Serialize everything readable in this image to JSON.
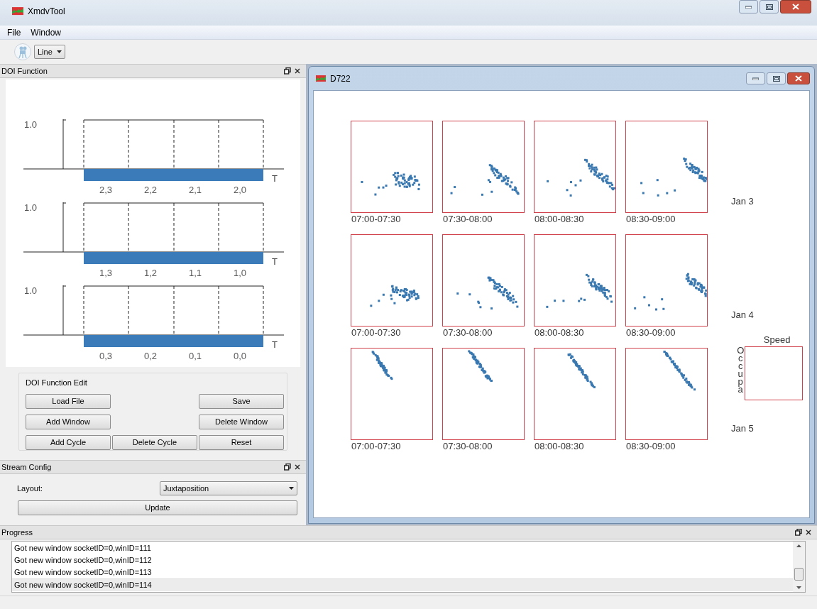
{
  "window": {
    "title": "XmdvTool"
  },
  "menu": [
    "File",
    "Window"
  ],
  "toolbar": {
    "mode": "Line"
  },
  "doi_function": {
    "title": "DOI Function",
    "rows": [
      {
        "y_label": "1.0",
        "axis_label": "T",
        "segments": [
          "2,3",
          "2,2",
          "2,1",
          "2,0"
        ]
      },
      {
        "y_label": "1.0",
        "axis_label": "T",
        "segments": [
          "1,3",
          "1,2",
          "1,1",
          "1,0"
        ]
      },
      {
        "y_label": "1.0",
        "axis_label": "T",
        "segments": [
          "0,3",
          "0,2",
          "0,1",
          "0,0"
        ]
      }
    ],
    "edit": {
      "title": "DOI Function Edit",
      "button_rows": [
        [
          "Load File",
          "Save"
        ],
        [
          "Add Window",
          "Delete Window"
        ],
        [
          "Add Cycle",
          "Delete Cycle",
          "Reset"
        ]
      ]
    }
  },
  "stream_config": {
    "title": "Stream Config",
    "layout_label": "Layout:",
    "layout_value": "Juxtaposition",
    "update_button": "Update"
  },
  "document_window": {
    "title": "D722",
    "rows": [
      {
        "date": "Jan 3",
        "cells": [
          "07:00-07:30",
          "07:30-08:00",
          "08:00-08:30",
          "08:30-09:00"
        ]
      },
      {
        "date": "Jan 4",
        "cells": [
          "07:00-07:30",
          "07:30-08:00",
          "08:00-08:30",
          "08:30-09:00"
        ]
      },
      {
        "date": "Jan 5",
        "cells": [
          "07:00-07:30",
          "07:30-08:00",
          "08:00-08:30",
          "08:30-09:00"
        ]
      }
    ],
    "legend": {
      "x_label": "Speed",
      "y_label": "Occupa"
    }
  },
  "progress": {
    "title": "Progress",
    "lines": [
      {
        "text": "Got new window socketID=0,winID=111",
        "selected": false
      },
      {
        "text": "Got new window socketID=0,winID=112",
        "selected": false
      },
      {
        "text": "Got new window socketID=0,winID=113",
        "selected": false
      },
      {
        "text": "Got new window socketID=0,winID=114",
        "selected": true
      }
    ]
  }
}
